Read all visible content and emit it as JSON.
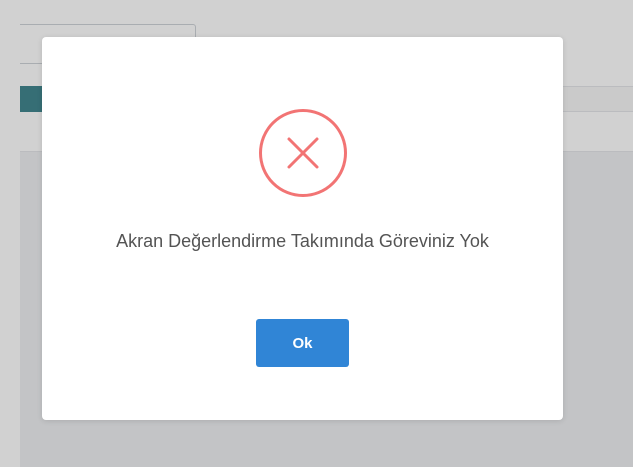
{
  "dialog": {
    "icon": "error-x-icon",
    "title": "Akran Değerlendirme Takımında Göreviniz Yok",
    "confirm_label": "Ok"
  },
  "colors": {
    "error": "#f27474",
    "confirm": "#3085d6",
    "text": "#545454",
    "accent_teal": "#43878f"
  }
}
